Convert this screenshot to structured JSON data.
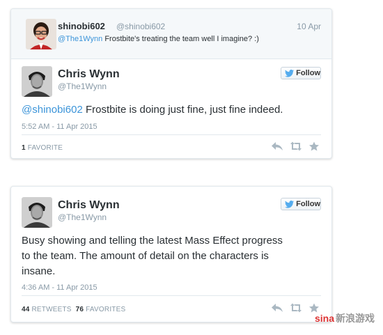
{
  "reply_tweet": {
    "name": "shinobi602",
    "handle": "@shinobi602",
    "date": "10 Apr",
    "mention": "@The1Wynn",
    "text": " Frostbite's treating the team well I imagine? :)"
  },
  "tweet1": {
    "name": "Chris Wynn",
    "handle": "@The1Wynn",
    "follow_label": "Follow",
    "mention": "@shinobi602",
    "text": " Frostbite is doing just fine, just fine indeed.",
    "timestamp": "5:52 AM - 11 Apr 2015",
    "favorites_count": "1",
    "favorites_label": "FAVORITE"
  },
  "tweet2": {
    "name": "Chris Wynn",
    "handle": "@The1Wynn",
    "follow_label": "Follow",
    "text_line1": "Busy showing and telling the latest Mass Effect progress",
    "text_line2": "to the team. The amount of detail on the characters is",
    "text_line3": "insane.",
    "timestamp": "4:36 AM - 11 Apr 2015",
    "retweets_count": "44",
    "retweets_label": "RETWEETS",
    "favorites_count": "76",
    "favorites_label": "FAVORITES"
  },
  "watermark": {
    "logo": "sina",
    "text": "新浪游戏"
  },
  "icons": [
    "reply-icon",
    "retweet-icon",
    "favorite-icon",
    "twitter-bird-icon"
  ],
  "colors": {
    "link": "#3b94d9",
    "muted": "#8899a6",
    "text": "#292f33",
    "bird": "#55acee"
  }
}
